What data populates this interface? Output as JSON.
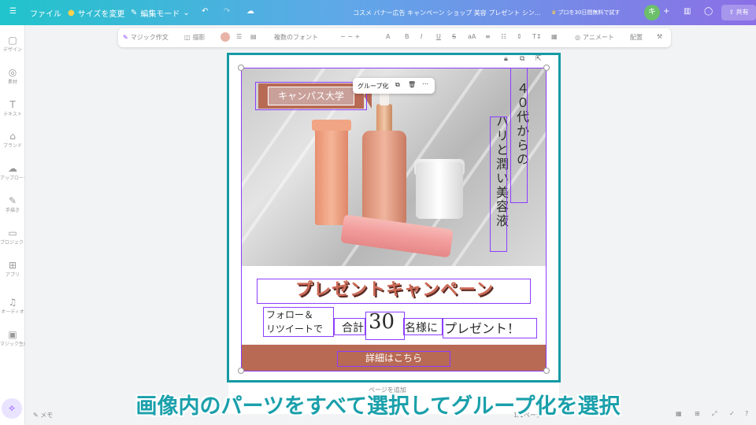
{
  "topbar": {
    "file": "ファイル",
    "resize": "サイズを変更",
    "edit_mode": "編集モード",
    "doc_title": "コスメ バナー広告 キャンペーン ショップ 美容 プレゼント シン...",
    "trial": "プロを30日間無料で試す",
    "avatar": "キ",
    "share": "共有"
  },
  "sidebar": {
    "items": [
      {
        "label": "デザイン",
        "icon": "▢"
      },
      {
        "label": "素材",
        "icon": "◎"
      },
      {
        "label": "テキスト",
        "icon": "T"
      },
      {
        "label": "ブランド",
        "icon": "⌂"
      },
      {
        "label": "アップロード",
        "icon": "☁"
      },
      {
        "label": "手描き",
        "icon": "✎"
      },
      {
        "label": "プロジェクト",
        "icon": "▭"
      },
      {
        "label": "アプリ",
        "icon": "⊞"
      },
      {
        "label": "オーディオ",
        "icon": "♫"
      },
      {
        "label": "マジック生成",
        "icon": "▣"
      }
    ]
  },
  "toolbar": {
    "magic_write": "マジック作文",
    "shadow": "描影",
    "font": "複数のフォント",
    "size": "−  −  +",
    "animate": "アニメート",
    "position": "配置"
  },
  "design": {
    "banner": "キャンパス大学",
    "vertical_1": "４０代からの",
    "vertical_2": "ハリと潤い美容液",
    "headline": "プレゼントキャンペーン",
    "follow_1": "フォロー＆",
    "follow_2": "リツイートで",
    "total": "合計",
    "number": "30",
    "people": "名様に",
    "present": "プレゼント！",
    "cta": "詳細はこちら"
  },
  "group_toolbar": {
    "group": "グループ化"
  },
  "caption": "画像内のパーツをすべて選択してグループ化を選択",
  "bottom": {
    "memo": "メモ",
    "pages": "1/1ページ",
    "add_page": "ページを追加"
  }
}
